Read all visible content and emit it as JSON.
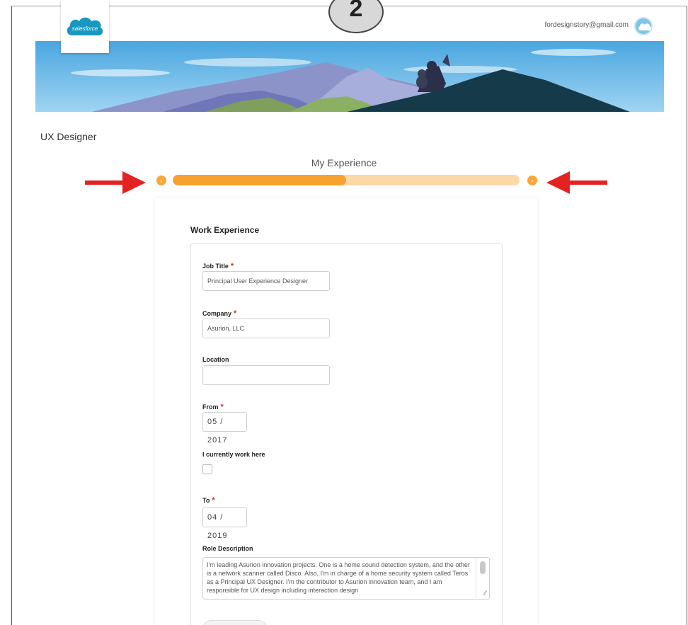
{
  "step": {
    "number": "2"
  },
  "header": {
    "logo_text": "salesforce",
    "user_email": "fordesignstory@gmail.com"
  },
  "page": {
    "title": "UX Designer"
  },
  "progress": {
    "label": "My Experience",
    "fraction": 0.5,
    "prev_icon": "chevron-left-icon",
    "next_icon": "chevron-right-icon",
    "colors": {
      "fill": "#f8a12e",
      "track": "#fcd8a8"
    }
  },
  "annotations": {
    "arrow_color": "#e52222"
  },
  "form": {
    "section_title": "Work Experience",
    "job_title": {
      "label": "Job Title",
      "value": "Principal User Experience Designer",
      "required": "*"
    },
    "company": {
      "label": "Company",
      "value": "Asurion, LLC",
      "required": "*"
    },
    "location": {
      "label": "Location",
      "value": ""
    },
    "from": {
      "label": "From",
      "value": "05 / 2017",
      "required": "*"
    },
    "current": {
      "label": "I currently work here",
      "checked": false
    },
    "to": {
      "label": "To",
      "value": "04 / 2019",
      "required": "*"
    },
    "role_description": {
      "label": "Role Description",
      "value": "I'm leading Asurion innovation projects. One is a home sound detection system, and the other is a network scanner called Disco. Also, I'm in charge of a home security system called Teros as a Principal UX Designer. I'm the contributor to Asurion innovation team, and I am responsible for UX design including interaction design"
    }
  }
}
